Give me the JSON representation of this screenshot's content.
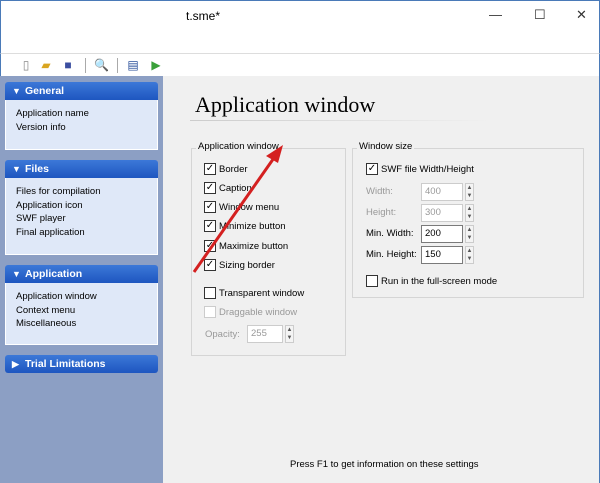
{
  "window": {
    "title": "t.sme*",
    "minimize": "—",
    "maximize": "☐",
    "close": "✕"
  },
  "toolbar": {
    "new": "new-icon",
    "open": "open-icon",
    "save": "save-icon",
    "preview": "preview-icon",
    "compile": "compile-icon",
    "run": "run-icon"
  },
  "sidebar": {
    "panels": [
      {
        "title": "General",
        "expanded": true,
        "items": [
          "Application name",
          "Version info"
        ]
      },
      {
        "title": "Files",
        "expanded": true,
        "items": [
          "Files for compilation",
          "Application icon",
          "SWF player",
          "Final application"
        ]
      },
      {
        "title": "Application",
        "expanded": true,
        "items": [
          "Application window",
          "Context menu",
          "Miscellaneous"
        ]
      },
      {
        "title": "Trial Limitations",
        "expanded": false,
        "items": []
      }
    ]
  },
  "main": {
    "title": "Application window",
    "app_group": {
      "label": "Application window",
      "options": [
        {
          "label": "Border",
          "checked": true
        },
        {
          "label": "Caption",
          "checked": true
        },
        {
          "label": "Window menu",
          "checked": true
        },
        {
          "label": "Minimize button",
          "checked": true
        },
        {
          "label": "Maximize button",
          "checked": true
        },
        {
          "label": "Sizing border",
          "checked": true
        },
        {
          "label": "Transparent window",
          "checked": false
        },
        {
          "label": "Draggable window",
          "checked": false,
          "disabled": true
        }
      ],
      "opacity_label": "Opacity:",
      "opacity_value": "255"
    },
    "size_group": {
      "label": "Window size",
      "swf_size_label": "SWF file Width/Height",
      "swf_size_checked": true,
      "width_label": "Width:",
      "width_value": "400",
      "height_label": "Height:",
      "height_value": "300",
      "min_width_label": "Min. Width:",
      "min_width_value": "200",
      "min_height_label": "Min. Height:",
      "min_height_value": "150",
      "fullscreen_label": "Run in the full-screen mode",
      "fullscreen_checked": false
    },
    "footer": "Press F1 to get information on these settings"
  },
  "annotation": {
    "arrow_color": "#d42020"
  }
}
